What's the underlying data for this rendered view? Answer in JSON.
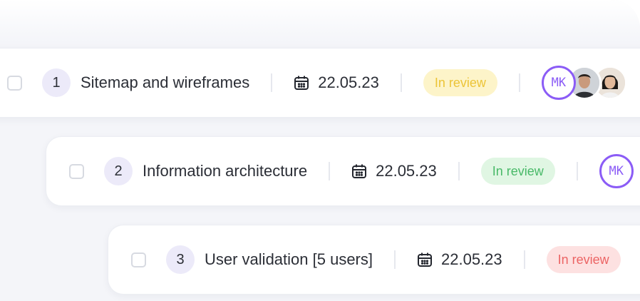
{
  "tasks": [
    {
      "number": "1",
      "title": "Sitemap and wireframes",
      "date": "22.05.23",
      "status": "In review",
      "status_color": "yellow",
      "avatars": {
        "initials": "MK"
      }
    },
    {
      "number": "2",
      "title": "Information architecture",
      "date": "22.05.23",
      "status": "In review",
      "status_color": "green",
      "avatars": {
        "initials": "MK"
      }
    },
    {
      "number": "3",
      "title": "User validation [5 users]",
      "date": "22.05.23",
      "status": "In review",
      "status_color": "red"
    }
  ],
  "colors": {
    "accent": "#8b5cf6",
    "yellow_badge": "#ecc437",
    "green_badge": "#48b968",
    "red_badge": "#ec6464"
  },
  "icons": {
    "date": "calendar-icon"
  }
}
